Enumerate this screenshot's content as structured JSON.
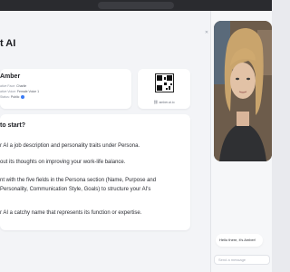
{
  "page": {
    "title": "t AI"
  },
  "profile": {
    "name": "Amber",
    "fields": [
      {
        "key": "ative Face:",
        "value": "Charlie"
      },
      {
        "key": "ative Voice:",
        "value": "Female Voice 1"
      },
      {
        "key": "Status:",
        "value": "Public"
      }
    ]
  },
  "qr": {
    "caption": "amber.ai.io"
  },
  "content": {
    "heading": "to start?",
    "lines": [
      "r AI a job description and personality traits under Persona.",
      "out its thoughts on improving your work-life balance.",
      "nt with the five fields in the Persona section (Name, Purpose and Personality, Communication Style, Goals) to structure your AI's",
      "r AI a catchy name that represents its function or expertise."
    ]
  },
  "chat": {
    "message": "Hello there, it's Amber!",
    "input_placeholder": "Send a message"
  },
  "icons": {
    "close": "close-icon",
    "status": "status-globe-icon",
    "link": "link-icon"
  },
  "colors": {
    "accent": "#3b7bf5",
    "background": "#f3f4f7",
    "card": "#ffffff"
  }
}
